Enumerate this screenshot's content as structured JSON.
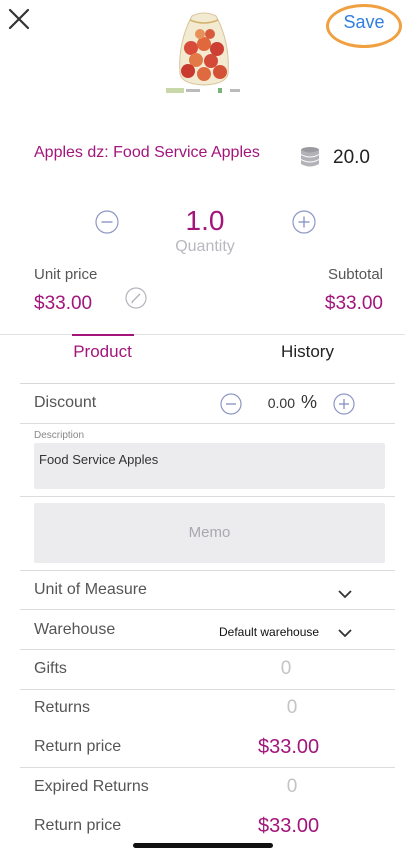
{
  "header": {
    "save_label": "Save"
  },
  "product": {
    "title": "Apples dz: Food Service Apples",
    "stock": "20.0"
  },
  "quantity": {
    "value": "1.0",
    "label": "Quantity"
  },
  "pricing": {
    "unit_price_label": "Unit price",
    "unit_price_value": "$33.00",
    "subtotal_label": "Subtotal",
    "subtotal_value": "$33.00"
  },
  "tabs": [
    {
      "label": "Product",
      "active": true
    },
    {
      "label": "History",
      "active": false
    }
  ],
  "discount": {
    "label": "Discount",
    "value": "0.00",
    "unit": "%"
  },
  "description": {
    "label": "Description",
    "value": "Food Service Apples"
  },
  "memo": {
    "placeholder": "Memo"
  },
  "rows": {
    "unit_of_measure": "Unit of Measure",
    "warehouse_label": "Warehouse",
    "warehouse_value": "Default warehouse",
    "gifts_label": "Gifts",
    "gifts_value": "0",
    "returns_label": "Returns",
    "returns_value": "0",
    "return_price_label": "Return price",
    "return_price_value": "$33.00",
    "expired_returns_label": "Expired Returns",
    "expired_returns_value": "0",
    "return_price2_label": "Return price",
    "return_price2_value": "$33.00"
  },
  "colors": {
    "accent": "#a3157b",
    "save_blue": "#2f7fe0",
    "highlight_ring": "#f0a040",
    "field_bg": "#ececef"
  },
  "icons": {
    "close": "close-icon",
    "stock": "database-stack-icon",
    "minus": "minus-circle-icon",
    "plus": "plus-circle-icon",
    "edit": "pencil-circle-icon",
    "chevron": "chevron-down-icon"
  }
}
